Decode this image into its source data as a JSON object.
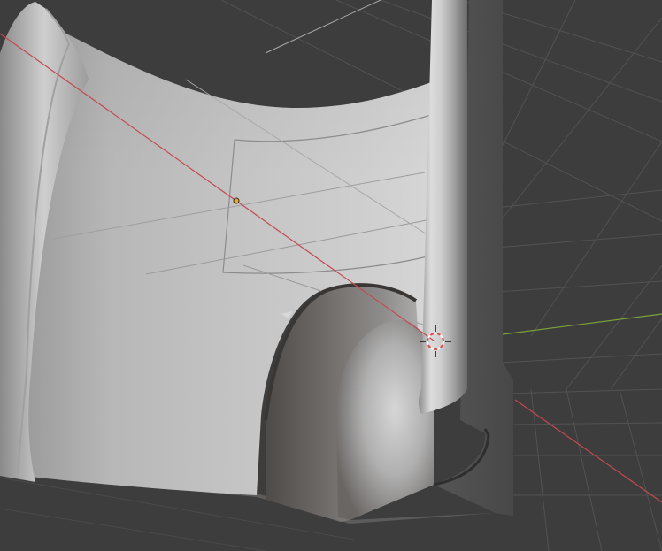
{
  "viewport": {
    "mode": "object-mode",
    "shading": "solid",
    "background_color": "#3d3d3d",
    "grid_color": "#525252"
  },
  "axes": {
    "x_axis_color": "#c4494f",
    "y_axis_color": "#7aa33a"
  },
  "mesh": {
    "base_color": "#b4b4b4",
    "shadow_color": "#4a4644",
    "highlight_color": "#e0e0e0"
  },
  "origin_point": {
    "color": "#f5a623"
  },
  "cursor_3d": {
    "ring_color": "#e34a4a",
    "alt_color": "#ffffff"
  },
  "icons": {
    "cursor": "crosshair-target-icon",
    "origin": "dot-icon"
  }
}
